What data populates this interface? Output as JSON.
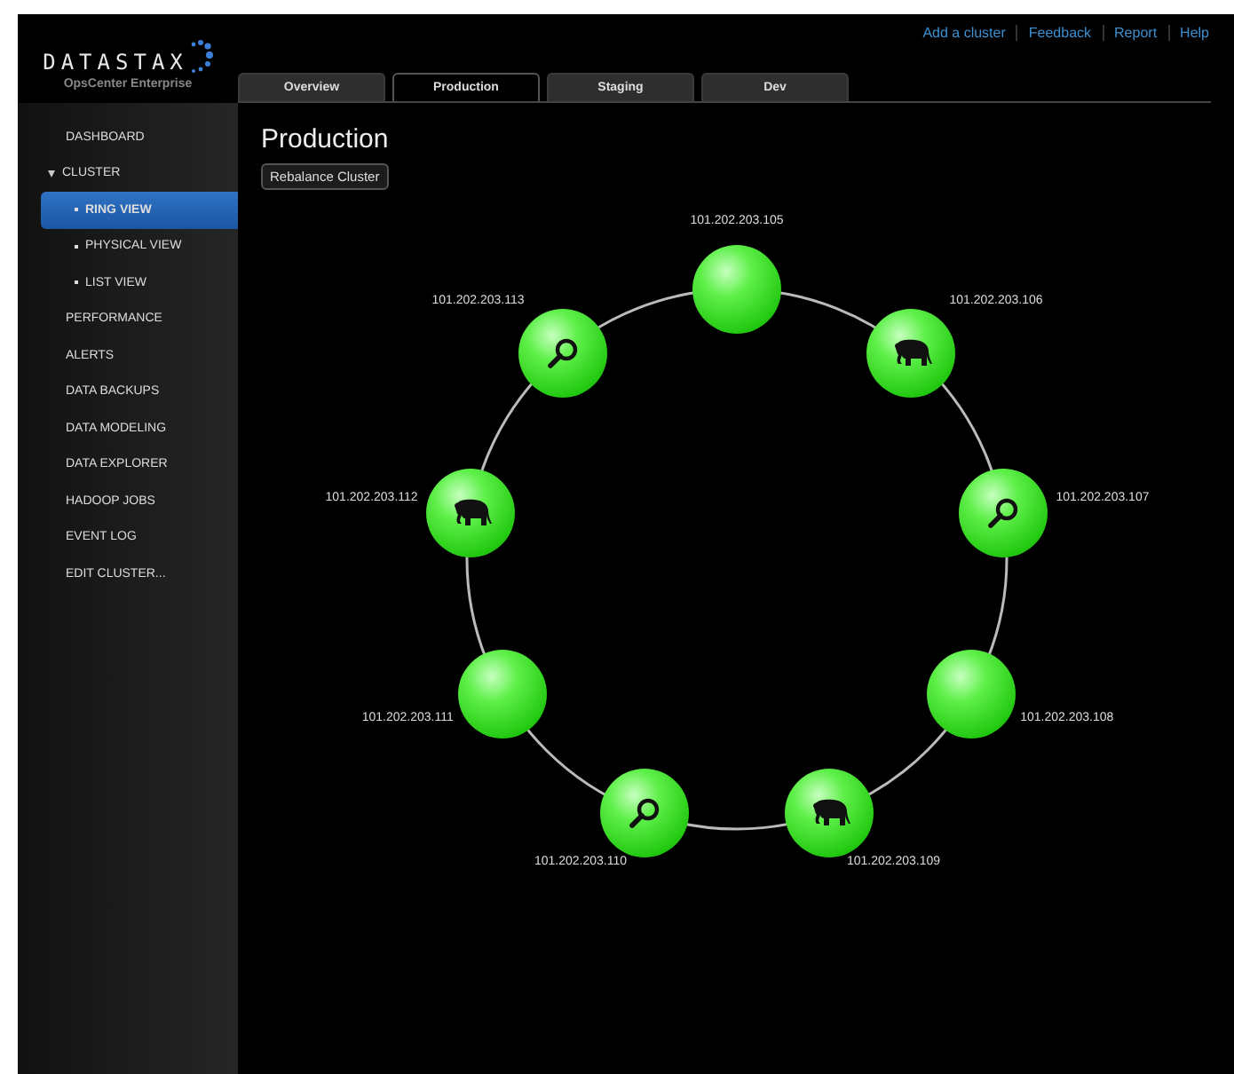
{
  "logo": {
    "name": "DATASTAX",
    "subtitle": "OpsCenter Enterprise"
  },
  "top_links": [
    "Add a cluster",
    "Feedback",
    "Report",
    "Help"
  ],
  "tabs": [
    {
      "label": "Overview",
      "selected": false
    },
    {
      "label": "Production",
      "selected": true
    },
    {
      "label": "Staging",
      "selected": false
    },
    {
      "label": "Dev",
      "selected": false
    }
  ],
  "sidebar": {
    "items": [
      {
        "label": "DASHBOARD",
        "selected": false
      },
      {
        "label": "CLUSTER",
        "selected": false,
        "expanded": true,
        "children": [
          {
            "label": "RING VIEW",
            "selected": true
          },
          {
            "label": "PHYSICAL VIEW",
            "selected": false
          },
          {
            "label": "LIST VIEW",
            "selected": false
          }
        ]
      },
      {
        "label": "PERFORMANCE",
        "selected": false
      },
      {
        "label": "ALERTS",
        "selected": false
      },
      {
        "label": "DATA BACKUPS",
        "selected": false
      },
      {
        "label": "DATA MODELING",
        "selected": false
      },
      {
        "label": "DATA EXPLORER",
        "selected": false
      },
      {
        "label": "HADOOP JOBS",
        "selected": false
      },
      {
        "label": "EVENT LOG",
        "selected": false
      },
      {
        "label": "EDIT CLUSTER...",
        "selected": false
      }
    ]
  },
  "page": {
    "title": "Production",
    "button": "Rebalance Cluster"
  },
  "ring": {
    "nodes": [
      {
        "address": "101.202.203.105",
        "kind": "plain"
      },
      {
        "address": "101.202.203.106",
        "kind": "hadoop"
      },
      {
        "address": "101.202.203.107",
        "kind": "search"
      },
      {
        "address": "101.202.203.108",
        "kind": "plain"
      },
      {
        "address": "101.202.203.109",
        "kind": "hadoop"
      },
      {
        "address": "101.202.203.110",
        "kind": "search"
      },
      {
        "address": "101.202.203.111",
        "kind": "plain"
      },
      {
        "address": "101.202.203.112",
        "kind": "hadoop"
      },
      {
        "address": "101.202.203.113",
        "kind": "search"
      }
    ]
  }
}
